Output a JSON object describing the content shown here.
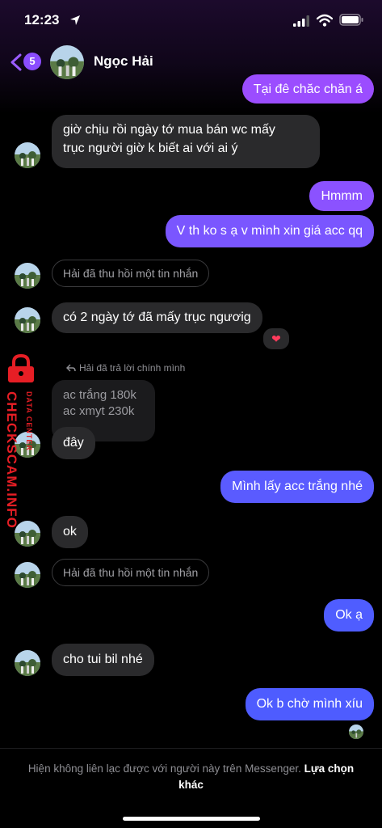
{
  "status_bar": {
    "time": "12:23"
  },
  "header": {
    "back_count": "5",
    "contact_name": "Ngọc Hải"
  },
  "messages": {
    "m1": "Tại đê chăc chăn á",
    "m2_line1": "giờ chịu rồi ngày tớ mua bán wc mấy",
    "m2_line2": "trục người giờ k biết ai với ai ý",
    "m3": "Hmmm",
    "m4": "V th ko s ạ v mình xin giá acc qq",
    "unsent1": "Hải đã thu hồi một tin nhắn",
    "m5": "có 2 ngày tớ đã mấy trục ngươig",
    "m5_reaction": "❤",
    "reply_label": "Hải đã trả lời chính mình",
    "quoted_line1": "ac trắng 180k",
    "quoted_line2": "ac xmyt 230k",
    "m6": "đây",
    "m7": "Mình lấy acc trắng nhé",
    "m8": "ok",
    "unsent2": "Hải đã thu hồi một tin nhắn",
    "m9": "Ok ạ",
    "m10": "cho tui bil nhé",
    "m11": "Ok b chờ mình xíu"
  },
  "watermark": {
    "main": "CHECKSCAM.INFO",
    "sub": "DATA CENTER"
  },
  "footer": {
    "text": "Hiện không liên lạc được với người này trên Messenger.",
    "link": "Lựa chọn khác"
  },
  "colors": {
    "bubble_out_top": "#9b4dff",
    "bubble_out_mid": "#8c52ff",
    "bubble_out_bottom": "#4e5cff",
    "bubble_in": "#2a2a2c",
    "badge": "#8b4dff",
    "watermark": "#e61e25"
  },
  "icons": [
    "location-arrow-icon",
    "signal-icon",
    "wifi-icon",
    "battery-icon",
    "back-chevron-icon",
    "reply-arrow-icon",
    "heart-reaction-icon",
    "lock-icon"
  ]
}
